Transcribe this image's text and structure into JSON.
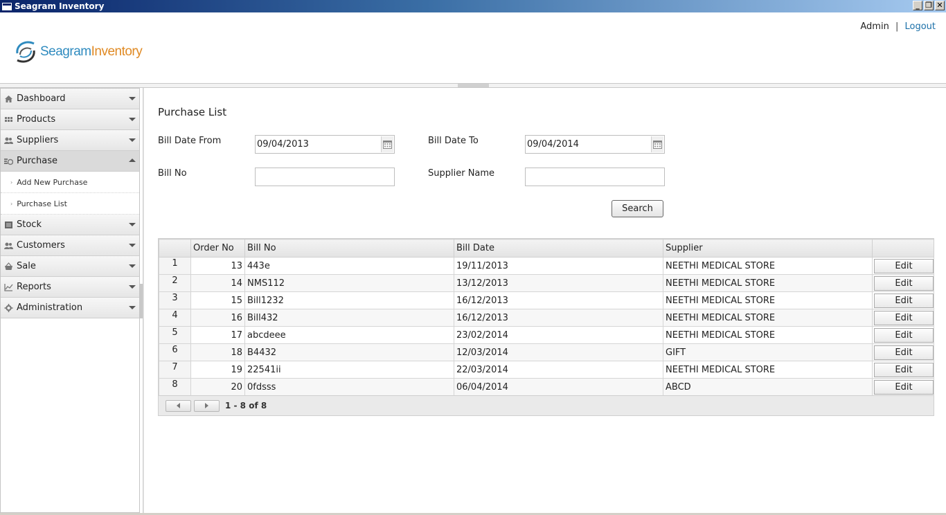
{
  "window": {
    "title": "Seagram Inventory",
    "controls": [
      "_",
      "❐",
      "✕"
    ]
  },
  "header": {
    "logo_part1": "Seagram",
    "logo_part2": "Inventory",
    "user": "Admin",
    "separator": "|",
    "logout": "Logout"
  },
  "sidebar": {
    "items": [
      {
        "label": "Dashboard",
        "icon": "home-icon"
      },
      {
        "label": "Products",
        "icon": "grid-icon"
      },
      {
        "label": "Suppliers",
        "icon": "users-icon"
      },
      {
        "label": "Purchase",
        "icon": "purchase-icon",
        "active": true
      },
      {
        "label": "Stock",
        "icon": "box-icon"
      },
      {
        "label": "Customers",
        "icon": "users-icon"
      },
      {
        "label": "Sale",
        "icon": "basket-icon"
      },
      {
        "label": "Reports",
        "icon": "chart-icon"
      },
      {
        "label": "Administration",
        "icon": "gear-icon"
      }
    ],
    "purchase_sub": [
      "Add New Purchase",
      "Purchase List"
    ]
  },
  "main": {
    "title": "Purchase List",
    "filters": {
      "bill_date_from_label": "Bill Date From",
      "bill_date_from_value": "09/04/2013",
      "bill_date_to_label": "Bill Date To",
      "bill_date_to_value": "09/04/2014",
      "bill_no_label": "Bill No",
      "bill_no_value": "",
      "supplier_name_label": "Supplier Name",
      "supplier_name_value": ""
    },
    "search_label": "Search"
  },
  "table": {
    "columns": [
      "",
      "Order No",
      "Bill No",
      "Bill Date",
      "Supplier",
      ""
    ],
    "rows": [
      {
        "n": "1",
        "order": "13",
        "bill": "443e",
        "date": "19/11/2013",
        "supplier": "NEETHI MEDICAL STORE",
        "action": "Edit"
      },
      {
        "n": "2",
        "order": "14",
        "bill": "NMS112",
        "date": "13/12/2013",
        "supplier": "NEETHI MEDICAL STORE",
        "action": "Edit"
      },
      {
        "n": "3",
        "order": "15",
        "bill": "Bill1232",
        "date": "16/12/2013",
        "supplier": "NEETHI MEDICAL STORE",
        "action": "Edit"
      },
      {
        "n": "4",
        "order": "16",
        "bill": "Bill432",
        "date": "16/12/2013",
        "supplier": "NEETHI MEDICAL STORE",
        "action": "Edit"
      },
      {
        "n": "5",
        "order": "17",
        "bill": "abcdeee",
        "date": "23/02/2014",
        "supplier": "NEETHI MEDICAL STORE",
        "action": "Edit"
      },
      {
        "n": "6",
        "order": "18",
        "bill": "B4432",
        "date": "12/03/2014",
        "supplier": "GIFT",
        "action": "Edit"
      },
      {
        "n": "7",
        "order": "19",
        "bill": "22541ii",
        "date": "22/03/2014",
        "supplier": "NEETHI MEDICAL STORE",
        "action": "Edit"
      },
      {
        "n": "8",
        "order": "20",
        "bill": "0fdsss",
        "date": "06/04/2014",
        "supplier": "ABCD",
        "action": "Edit"
      }
    ],
    "pager_info": "1 - 8 of 8"
  },
  "colors": {
    "logo_blue": "#2f8bbf",
    "logo_orange": "#e08a24",
    "link": "#1a6fa8"
  }
}
